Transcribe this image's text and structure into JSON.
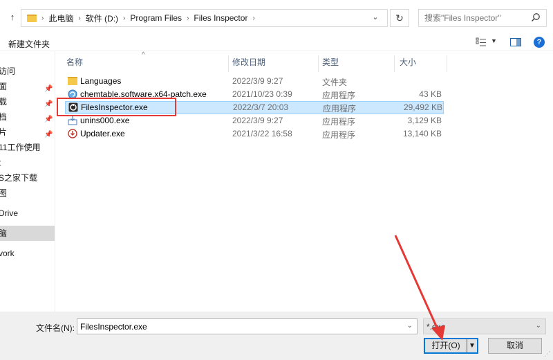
{
  "address": {
    "up_arrow": "↑",
    "breadcrumbs": [
      "此电脑",
      "软件 (D:)",
      "Program Files",
      "Files Inspector"
    ],
    "refresh": "↻",
    "search_placeholder": "搜索\"Files Inspector\""
  },
  "toolbar": {
    "new_folder": "新建文件夹"
  },
  "sidebar": {
    "items": [
      {
        "label": "访问"
      },
      {
        "label": "面"
      },
      {
        "label": "载"
      },
      {
        "label": "档"
      },
      {
        "label": "片"
      },
      {
        "label": "11工作使用"
      },
      {
        "label": "t"
      },
      {
        "label": "S之家下载"
      },
      {
        "label": "图"
      },
      {
        "label": "Drive"
      },
      {
        "label": "脑"
      },
      {
        "label": "vork"
      }
    ]
  },
  "columns": {
    "name": "名称",
    "date": "修改日期",
    "type": "类型",
    "size": "大小"
  },
  "files": [
    {
      "name": "Languages",
      "date": "2022/3/9 9:27",
      "type": "文件夹",
      "size": "",
      "icon": "folder-icon"
    },
    {
      "name": "chemtable.software.x64-patch.exe",
      "date": "2021/10/23 0:39",
      "type": "应用程序",
      "size": "43 KB",
      "icon": "patch-exe-icon"
    },
    {
      "name": "FilesInspector.exe",
      "date": "2022/3/7 20:03",
      "type": "应用程序",
      "size": "29,492 KB",
      "icon": "files-inspector-icon"
    },
    {
      "name": "unins000.exe",
      "date": "2022/3/9 9:27",
      "type": "应用程序",
      "size": "3,129 KB",
      "icon": "uninstaller-icon"
    },
    {
      "name": "Updater.exe",
      "date": "2021/3/22 16:58",
      "type": "应用程序",
      "size": "13,140 KB",
      "icon": "updater-icon"
    }
  ],
  "bottom": {
    "filename_label": "文件名(N):",
    "filename_value": "FilesInspector.exe",
    "filetype_value": "*.exe",
    "open_label": "打开(O)",
    "cancel_label": "取消"
  },
  "colors": {
    "selection": "#cce8ff",
    "highlight_frame": "#e53935",
    "accent": "#0078d7"
  }
}
